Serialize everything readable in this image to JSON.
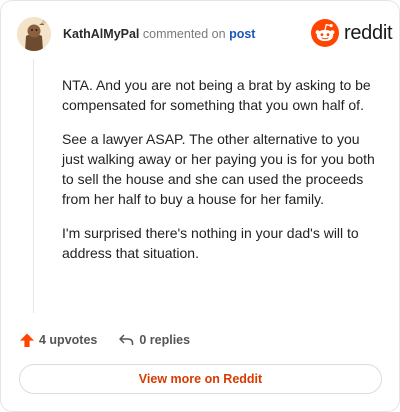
{
  "comment": {
    "author": "KathAlMyPal",
    "action_text": "commented on",
    "post_link": "post",
    "paragraphs": [
      "NTA. And you are not being a brat by asking to be compensated for something that you own half of.",
      "See a lawyer ASAP. The other alternative to you just walking away or her paying you is for you both to sell the house and she can used the proceeds from her half to buy a house for her family.",
      "I'm surprised there's nothing in your dad's will to address that situation."
    ]
  },
  "brand": {
    "name": "reddit",
    "color": "#ff4500"
  },
  "actions": {
    "upvotes": "4 upvotes",
    "replies": "0 replies"
  },
  "footer": {
    "view_more": "View more on Reddit"
  },
  "icons": {
    "avatar": "avatar-icon",
    "logo": "reddit-logo-icon",
    "upvote": "upvote-arrow-icon",
    "reply": "reply-arrow-icon"
  },
  "colors": {
    "accent": "#d93a00",
    "link": "#1c57b8",
    "upvote": "#ff4500"
  }
}
